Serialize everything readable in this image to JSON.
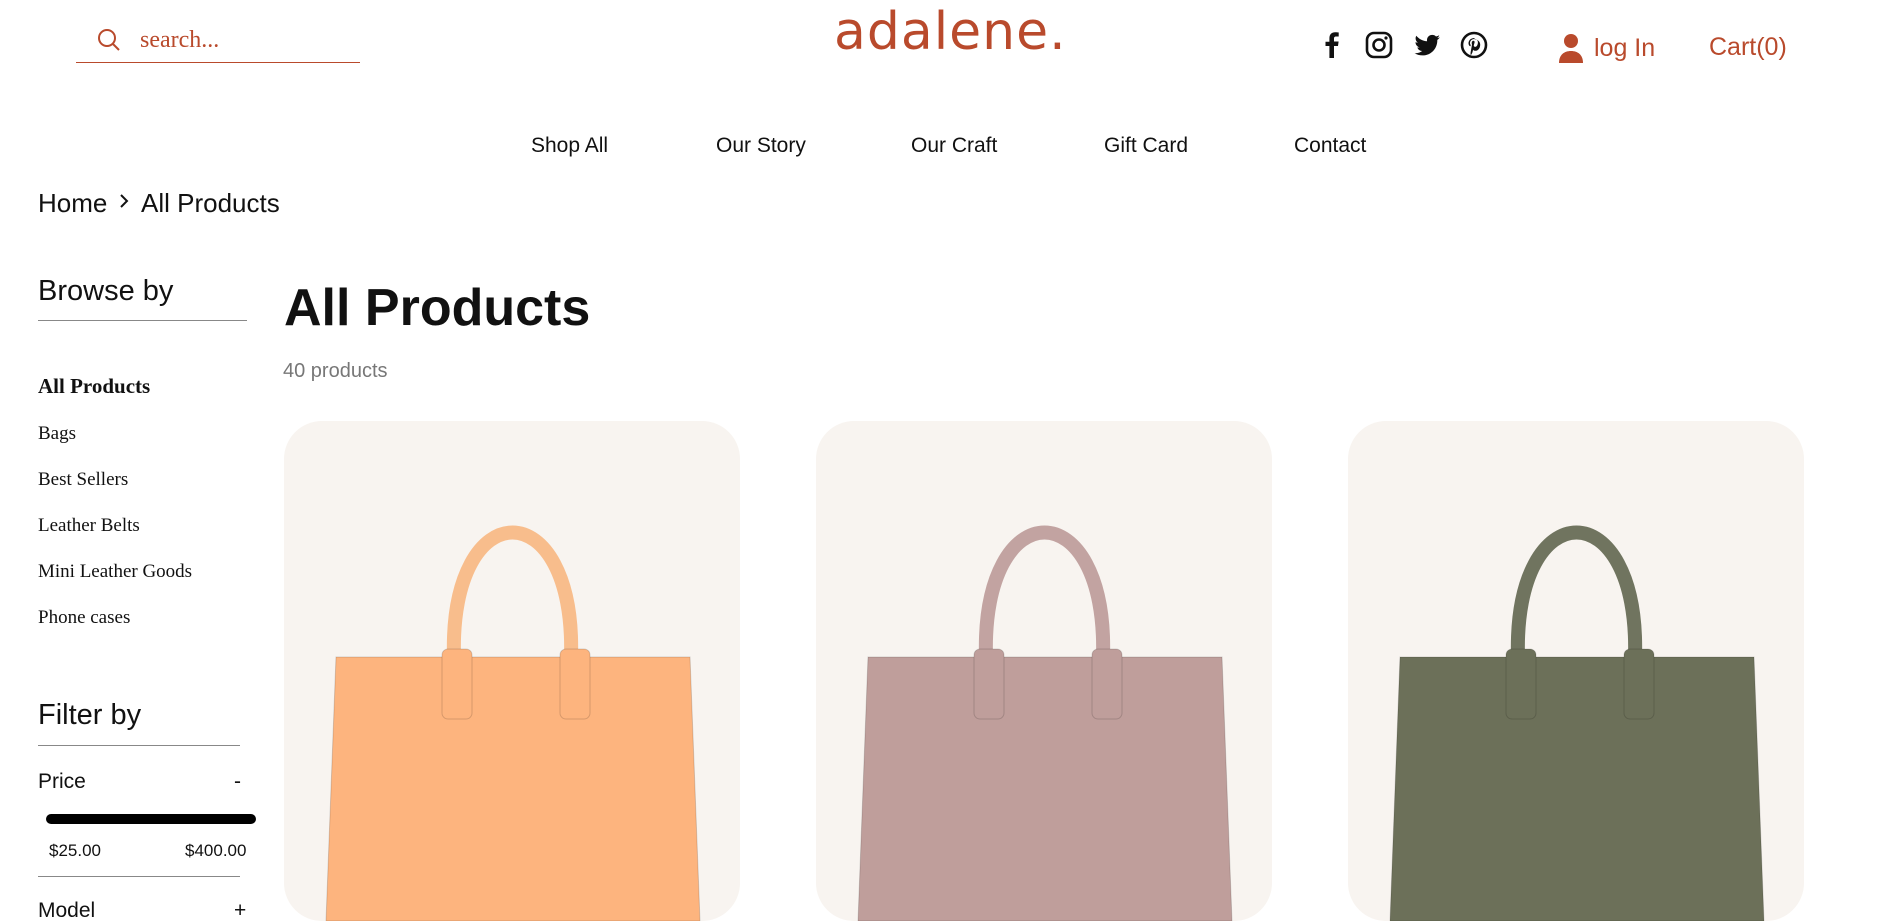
{
  "header": {
    "search_placeholder": "search...",
    "logo": "adalene.",
    "login_label": "log In",
    "cart_label": "Cart(0)",
    "social_icons": [
      "facebook-icon",
      "instagram-icon",
      "twitter-icon",
      "pinterest-icon"
    ]
  },
  "nav": {
    "items": [
      "Shop All",
      "Our Story",
      "Our Craft",
      "Gift Card",
      "Contact"
    ]
  },
  "breadcrumb": {
    "home": "Home",
    "current": "All Products"
  },
  "sidebar": {
    "browse_heading": "Browse by",
    "categories": [
      "All Products",
      "Bags",
      "Best Sellers",
      "Leather Belts",
      "Mini Leather Goods",
      "Phone cases"
    ],
    "filter_heading": "Filter by",
    "price_label": "Price",
    "price_toggle": "-",
    "price_min": "$25.00",
    "price_max": "$400.00",
    "model_label": "Model",
    "model_toggle": "+"
  },
  "main": {
    "title": "All Products",
    "count": "40 products"
  },
  "products": [
    {
      "color": "#fdb47e",
      "handle": "#f8bd8c"
    },
    {
      "color": "#bf9e9b",
      "handle": "#c2a3a1"
    },
    {
      "color": "#6c7059",
      "handle": "#70745f"
    }
  ],
  "colors": {
    "accent": "#b94a2c",
    "card_bg": "#f8f4f0"
  }
}
